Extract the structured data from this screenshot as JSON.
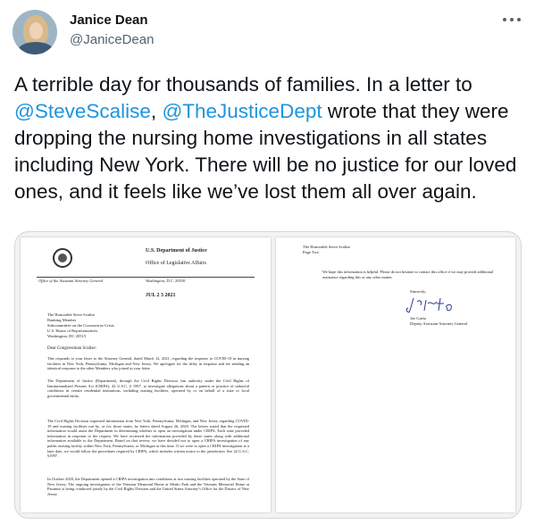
{
  "author": {
    "name": "Janice Dean",
    "handle": "@JaniceDean"
  },
  "tweet": {
    "text_1": "A terrible day for thousands of families. In a letter to ",
    "mention_1": "@SteveScalise",
    "text_2": ", ",
    "mention_2": "@TheJusticeDept",
    "text_3": " wrote that they were dropping the nursing home investigations in all states including New York. There will be no justice for our loved ones, and it feels like we’ve lost them all over again."
  },
  "media": {
    "page1": {
      "letterhead_1": "U.S. Department of Justice",
      "letterhead_2": "Office of Legislative Affairs",
      "office_left": "Office of the Assistant Attorney General",
      "office_right": "Washington, D.C. 20530",
      "date": "JUL 2 3 2021",
      "address": "The Honorable Steve Scalise\nRanking Member\nSubcommittee on the Coronavirus Crisis\nU.S. House of Representatives\nWashington, DC 20515",
      "salutation": "Dear Congressman Scalise:",
      "para_1": "This responds to your letter to the Attorney General, dated March 12, 2021, regarding the response to COVID-19 in nursing facilities in New York, Pennsylvania, Michigan and New Jersey. We apologize for the delay in response and are sending an identical response to the other Members who joined in your letter.",
      "para_2": "The Department of Justice (Department), through the Civil Rights Division, has authority under the Civil Rights of Institutionalized Persons Act (CRIPA), 42 U.S.C. § 1997, to investigate allegations about a pattern or practice of unlawful conditions in certain residential institutions, including nursing facilities, operated by or on behalf of a state or local governmental entity.",
      "para_3": "The Civil Rights Division requested information from New York, Pennsylvania, Michigan, and New Jersey regarding COVID-19 and nursing facilities run by, or for, those states, by letters dated August 26, 2020. The letters stated that the requested information would assist the Department in determining whether to open an investigation under CRIPA. Each state provided information in response to the request. We have reviewed the information provided by these states along with additional information available to the Department. Based on that review, we have decided not to open a CRIPA investigation of any public nursing facility within New York, Pennsylvania, or Michigan at this time. If we were to open a CRIPA investigation at a later date, we would follow the procedures required by CRIPA, which includes written notice to the jurisdiction. See 42 U.S.C. §1997.",
      "para_4": "In October 2020, the Department opened a CRIPA investigation into conditions at two nursing facilities operated by the State of New Jersey. The ongoing investigation of the Veterans Memorial Home at Menlo Park and the Veterans Memorial Home at Paramus is being conducted jointly by the Civil Rights Division and the United States Attorney’s Office for the District of New Jersey."
    },
    "page2": {
      "address": "The Honorable Steve Scalise\nPage Two",
      "para_1": "We hope this information is helpful. Please do not hesitate to contact this office if we may provide additional assistance regarding this or any other matter.",
      "closing": "Sincerely,",
      "signer": "Joe Gaeta\nDeputy Assistant Attorney General"
    }
  }
}
